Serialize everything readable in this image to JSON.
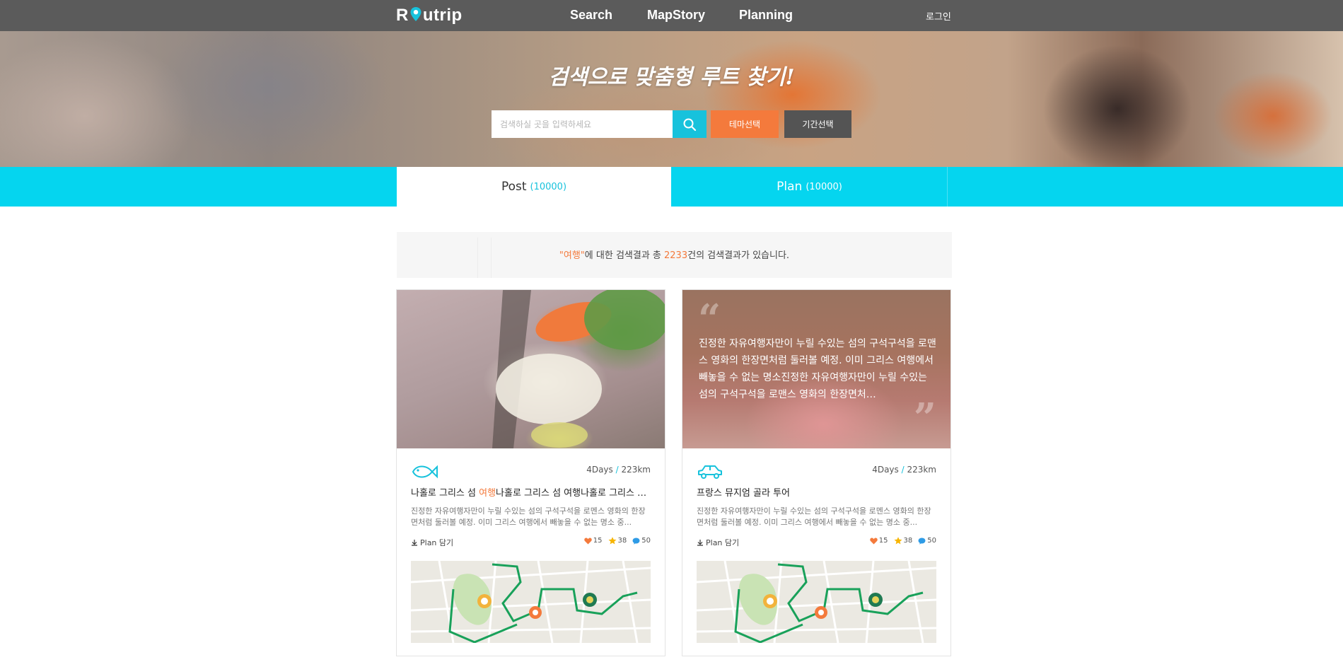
{
  "brand": {
    "logo_text_pre": "R",
    "logo_text_post": "utrip",
    "accent": "#17c2dc",
    "orange": "#f47a3c"
  },
  "nav": {
    "items": [
      "Search",
      "MapStory",
      "Planning"
    ],
    "login": "로그인"
  },
  "hero": {
    "title": "검색으로 맞춤형 루트 찾기!",
    "search_placeholder": "검색하실 곳을 입력하세요",
    "search_icon": "search-icon",
    "theme_button": "테마선택",
    "period_button": "기간선택"
  },
  "tabs": [
    {
      "label": "Post",
      "count": "(10000)",
      "active": true
    },
    {
      "label": "Plan",
      "count": "(10000)",
      "active": false
    }
  ],
  "summary": {
    "quote_open": "\"",
    "keyword": "여행",
    "quote_close": "\"",
    "text_mid": "에 대한 검색결과 총 ",
    "total": "2233",
    "text_end": "건의 검색결과가 있습니다."
  },
  "cards": [
    {
      "icon": "fish-icon",
      "days": "4Days",
      "slash": " / ",
      "distance": "223km",
      "title_pre": "나홀로 그리스 섬 ",
      "title_highlight": "여행",
      "title_post": "나홀로 그리스 섬 여행나홀로 그리스 섬 여행",
      "desc": "진정한 자유여행자만이 누릴 수있는 섬의 구석구석을 로멘스 영화의 한장면처럼 둘러볼 예정. 이미 그리스 여행에서 빼놓을 수 없는 명소 중...",
      "plan_label": "Plan 담기",
      "likes": "15",
      "stars": "38",
      "comments": "50"
    },
    {
      "icon": "car-icon",
      "quote": "진정한 자유여행자만이 누릴 수있는 섬의 구석구석을 로맨스 영화의 한장면처럼 둘러볼 예정. 이미 그리스 여행에서 빼놓을 수 없는 명소진정한 자유여행자만이 누릴 수있는 섬의 구석구석을 로맨스 영화의 한장면처…",
      "days": "4Days",
      "slash": " / ",
      "distance": "223km",
      "title": "프랑스 뮤지엄 골라 투어",
      "desc": "진정한 자유여행자만이 누릴 수있는 섬의 구석구석을 로멘스 영화의 한장면처럼 둘러볼 예정. 이미 그리스 여행에서 빼놓을 수 없는 명소 중...",
      "plan_label": "Plan 담기",
      "likes": "15",
      "stars": "38",
      "comments": "50"
    }
  ]
}
